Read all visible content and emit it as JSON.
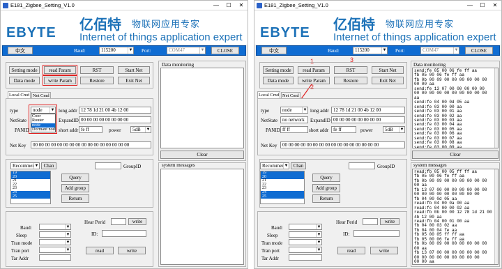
{
  "window": {
    "title": "E181_Zigbee_Setting_V1.0",
    "icon": "app-icon",
    "minimize": "—",
    "maximize": "☐",
    "close": "✕"
  },
  "logo": {
    "brand": "EBYTE",
    "cn_name": "亿佰特",
    "cn_slogan": "物联网应用专家",
    "en_slogan": "Internet of things application expert"
  },
  "toolbar": {
    "lang": "中文",
    "baud_label": "Baud:",
    "baud_value": "115200",
    "port_label": "Port:",
    "port_value": "COM47",
    "close_label": "CLOSE"
  },
  "buttons": {
    "setting_mode": "Setting mode",
    "read_param": "read Param",
    "rst": "RST",
    "start_net": "Start Net",
    "data_mode": "Data mode",
    "write_param": "write Param",
    "restore": "Restore",
    "exit_net": "Exit Net"
  },
  "tabs": {
    "local": "Local Cmd",
    "net": "Net Cmd"
  },
  "form": {
    "type_label": "type",
    "type_value": "node",
    "long_addr_label": "long addr",
    "long_addr_value": "12 78 1d 21 00 4b 12 00",
    "netstate_label": "NetState",
    "netstate_value_left": "",
    "netstate_value_right": "no network",
    "expandid_label": "ExpandID",
    "expandid_value": "00 00 00 00 00 00 00 00",
    "panid_label": "PANID",
    "panid_value": "ff ff",
    "short_addr_label": "short addr",
    "short_addr_value": "fe ff",
    "power_label": "power",
    "power_value": "5dB",
    "netkey_label": "Net Key",
    "netkey_value": "00 00 00 00 00 00 00 00 00 00 00 00 00 00 00 00"
  },
  "type_dropdown": [
    "Coor",
    "Router",
    "node",
    "Dormant nod"
  ],
  "group": {
    "mode_value": "Recommend",
    "chan_label": "Chan",
    "groupid_label": "GroupID",
    "list": [
      "19",
      "20",
      "21",
      "22",
      "23",
      "24",
      "25"
    ],
    "query": "Query",
    "add_group": "Add group",
    "return": "Return"
  },
  "bottom": {
    "baud_label": "Baud:",
    "sleep_label": "Sleep",
    "tran_mode_label": "Tran mode",
    "tran_port_label": "Tran port",
    "tar_addr_label": "Tar Addr",
    "hear_perid_label": "Hear Perid",
    "id_label": "ID:",
    "write": "write",
    "read": "read"
  },
  "monitor": {
    "label": "Data monitoring",
    "clear": "Clear",
    "lines": [
      "send:fe 05 00 06 fe ff aa",
      "fb 05 00 06 fe ff aa",
      "fb 0b 00 09 00 00 00 00 00 00",
      "00 00 aa",
      "send:fe 13 07 00 00 00 00 00",
      "00 00 00 00 00 00 00 00 00 00",
      "aa",
      "send:fe 04 00 0d 05 aa",
      "send:fe 03 00 00 aa",
      "send:fe 03 00 01 aa",
      "send:fe 03 00 02 aa",
      "send:fe 03 00 03 aa",
      "send:fe 03 00 04 aa",
      "send:fe 03 00 05 aa",
      "send:fe 03 00 06 aa",
      "send:fe 03 00 07 aa",
      "send:fe 03 00 08 aa",
      "send:fe 03 00 09 aa"
    ]
  },
  "system": {
    "label": "system messages",
    "lines": [
      "read:fb 05 00 05 ff ff aa",
      "fb 05 00 06 fe ff aa",
      "fb 0b 00 09 00 00 00 00 00 00",
      "00 aa",
      "fb 13 07 00 00 00 00 00 00 00",
      "00 00 00 00 00 00 00 00 00",
      "fb 04 00 0d 05 aa",
      "read:fb 04 00 0a 00 aa",
      "read:fc 04 00 00 02 aa",
      "read:fb 0b 00 00 12 78 1d 21 00",
      "4b 12 00 aa",
      "read:fb 04 00 01 00 aa",
      "fb 04 00 03 02 aa",
      "fb 04 00 04 fe aa",
      "fb 05 00 05 ff ff aa",
      "fb 05 00 06 fe ff aa",
      "fb 0b 00 09 00 00 00 00 00 00",
      "00 aa",
      "fb 13 07 00 00 00 00 00 00 00",
      "00 00 00 00 00 00 00 00 00",
      "00 00 aa",
      "fb 04 00 0d 05 aa"
    ]
  },
  "annotations": {
    "n1": "1",
    "n2": "2",
    "n3": "3"
  }
}
